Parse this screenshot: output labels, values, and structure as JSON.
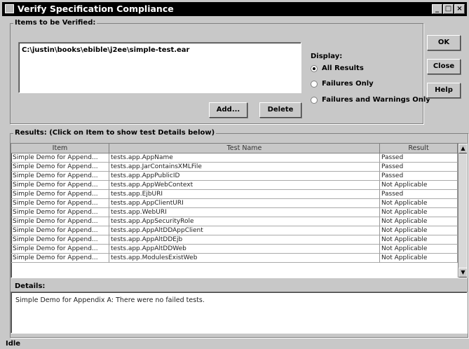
{
  "window": {
    "title": "Verify Specification Compliance",
    "controls": {
      "minimize": "_",
      "maximize": "□",
      "close": "×"
    }
  },
  "items_group": {
    "legend": "Items to be Verified:",
    "files": [
      "C:\\justin\\books\\ebible\\j2ee\\simple-test.ear"
    ],
    "add_label": "Add...",
    "delete_label": "Delete"
  },
  "display": {
    "label": "Display:",
    "options": [
      {
        "label": "All Results",
        "selected": true
      },
      {
        "label": "Failures Only",
        "selected": false
      },
      {
        "label": "Failures and Warnings Only",
        "selected": false
      }
    ]
  },
  "side_buttons": {
    "ok": "OK",
    "close": "Close",
    "help": "Help"
  },
  "results": {
    "legend": "Results: (Click on Item to show test Details below)",
    "columns": [
      "Item",
      "Test Name",
      "Result"
    ],
    "rows": [
      [
        "Simple Demo for Append...",
        "tests.app.AppName",
        "Passed"
      ],
      [
        "Simple Demo for Append...",
        "tests.app.JarContainsXMLFile",
        "Passed"
      ],
      [
        "Simple Demo for Append...",
        "tests.app.AppPublicID",
        "Passed"
      ],
      [
        "Simple Demo for Append...",
        "tests.app.AppWebContext",
        "Not Applicable"
      ],
      [
        "Simple Demo for Append...",
        "tests.app.EjbURI",
        "Passed"
      ],
      [
        "Simple Demo for Append...",
        "tests.app.AppClientURI",
        "Not Applicable"
      ],
      [
        "Simple Demo for Append...",
        "tests.app.WebURI",
        "Not Applicable"
      ],
      [
        "Simple Demo for Append...",
        "tests.app.AppSecurityRole",
        "Not Applicable"
      ],
      [
        "Simple Demo for Append...",
        "tests.app.AppAltDDAppClient",
        "Not Applicable"
      ],
      [
        "Simple Demo for Append...",
        "tests.app.AppAltDDEjb",
        "Not Applicable"
      ],
      [
        "Simple Demo for Append...",
        "tests.app.AppAltDDWeb",
        "Not Applicable"
      ],
      [
        "Simple Demo for Append...",
        "tests.app.ModulesExistWeb",
        "Not Applicable"
      ]
    ]
  },
  "details": {
    "label": "Details:",
    "text": "Simple Demo for Appendix A: There were no failed tests."
  },
  "status": "Idle"
}
